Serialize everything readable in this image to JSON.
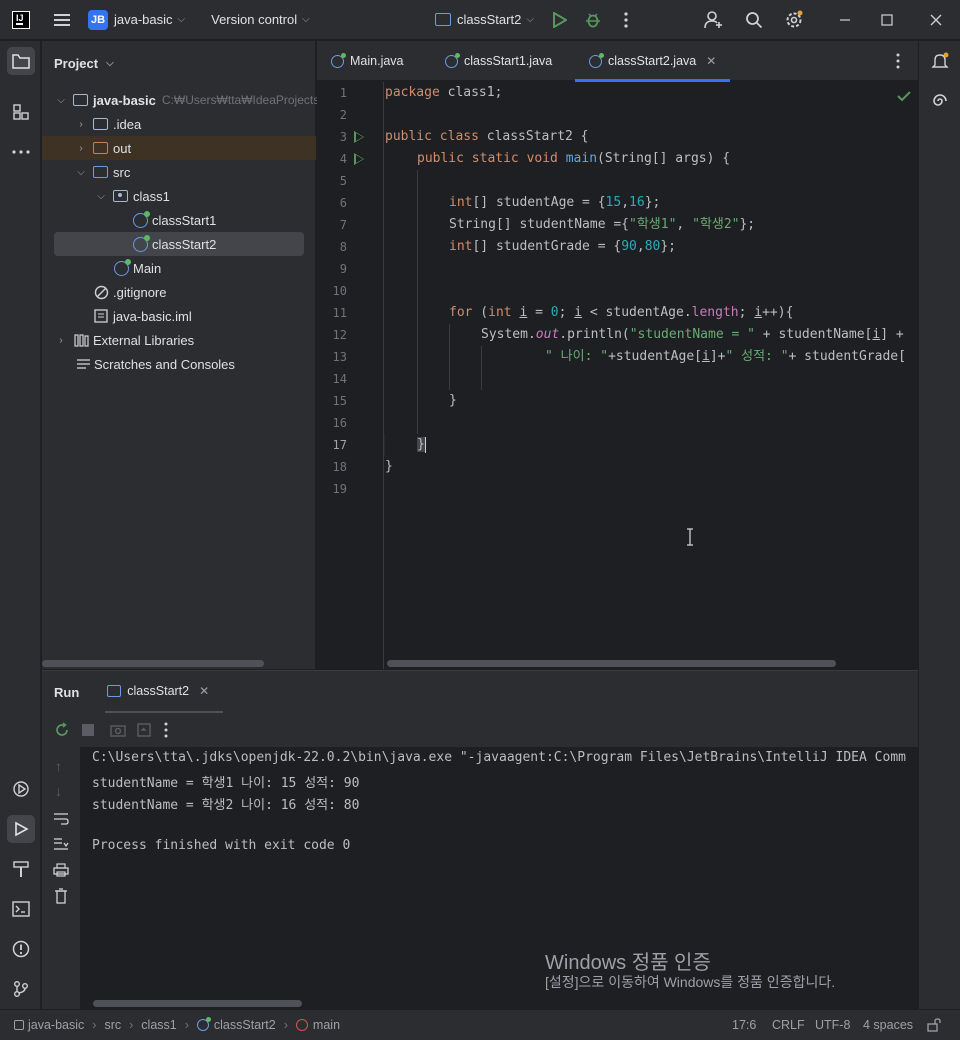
{
  "titlebar": {
    "project_badge": "JB",
    "project_name": "java-basic",
    "vcs": "Version control",
    "run_config": "classStart2"
  },
  "project_panel": {
    "title": "Project",
    "root": {
      "name": "java-basic",
      "path": "C:₩Users₩tta₩IdeaProjects₩ja"
    },
    "items": [
      {
        "label": ".idea"
      },
      {
        "label": "out"
      },
      {
        "label": "src"
      },
      {
        "label": "class1"
      },
      {
        "label": "classStart1"
      },
      {
        "label": "classStart2"
      },
      {
        "label": "Main"
      },
      {
        "label": ".gitignore"
      },
      {
        "label": "java-basic.iml"
      },
      {
        "label": "External Libraries"
      },
      {
        "label": "Scratches and Consoles"
      }
    ]
  },
  "editor": {
    "tabs": [
      {
        "label": "Main.java"
      },
      {
        "label": "classStart1.java"
      },
      {
        "label": "classStart2.java"
      }
    ],
    "line_numbers": [
      "1",
      "2",
      "3",
      "4",
      "5",
      "6",
      "7",
      "8",
      "9",
      "10",
      "11",
      "12",
      "13",
      "14",
      "15",
      "16",
      "17",
      "18",
      "19"
    ],
    "code": {
      "l1_kw": "package",
      "l1_rest": " class1;",
      "l3_kw": "public class",
      "l3_rest": " classStart2 {",
      "l4_kw": "public static void",
      "l4_fn": "main",
      "l4_rest": "(String[] args) {",
      "l6_kw": "int",
      "l6_a": "[] studentAge = {",
      "l6_n1": "15",
      "l6_b": ",",
      "l6_n2": "16",
      "l6_c": "};",
      "l7_a": "String[] studentName ={",
      "l7_s1": "\"학생1\"",
      "l7_b": ", ",
      "l7_s2": "\"학생2\"",
      "l7_c": "};",
      "l8_kw": "int",
      "l8_a": "[] studentGrade = {",
      "l8_n1": "90",
      "l8_b": ",",
      "l8_n2": "80",
      "l8_c": "};",
      "l11_kw": "for",
      "l11_a": " (",
      "l11_kw2": "int",
      "l11_b": " ",
      "l11_i1": "i",
      "l11_c": " = ",
      "l11_n": "0",
      "l11_d": "; ",
      "l11_i2": "i",
      "l11_e": " < studentAge.",
      "l11_f": "length",
      "l11_g": "; ",
      "l11_i3": "i",
      "l11_h": "++){",
      "l12_a": "System.",
      "l12_out": "out",
      "l12_b": ".println(",
      "l12_s": "\"studentName = \"",
      "l12_c": " + studentName[",
      "l12_i": "i",
      "l12_d": "] +",
      "l13_s1": "\" 나이: \"",
      "l13_a": "+studentAge[",
      "l13_i": "i",
      "l13_b": "]+",
      "l13_s2": "\" 성적: \"",
      "l13_c": "+ studentGrade[",
      "l15": "}",
      "l17": "}",
      "l18": "}"
    }
  },
  "run_panel": {
    "title": "Run",
    "tab": "classStart2",
    "output": [
      "C:\\Users\\tta\\.jdks\\openjdk-22.0.2\\bin\\java.exe \"-javaagent:C:\\Program Files\\JetBrains\\IntelliJ IDEA Comm",
      "studentName = 학생1 나이: 15 성적: 90",
      "studentName = 학생2 나이: 16 성적: 80",
      "",
      "Process finished with exit code 0"
    ]
  },
  "watermark": {
    "title": "Windows 정품 인증",
    "subtitle": "[설정]으로 이동하여 Windows를 정품 인증합니다."
  },
  "statusbar": {
    "breadcrumbs": [
      "java-basic",
      "src",
      "class1",
      "classStart2",
      "main"
    ],
    "position": "17:6",
    "line_sep": "CRLF",
    "encoding": "UTF-8",
    "indent": "4 spaces"
  },
  "colors": {
    "accent": "#3574f0",
    "run_green": "#57965c",
    "keyword": "#cf8e6d",
    "string": "#6aab73",
    "number": "#2aacb8"
  }
}
